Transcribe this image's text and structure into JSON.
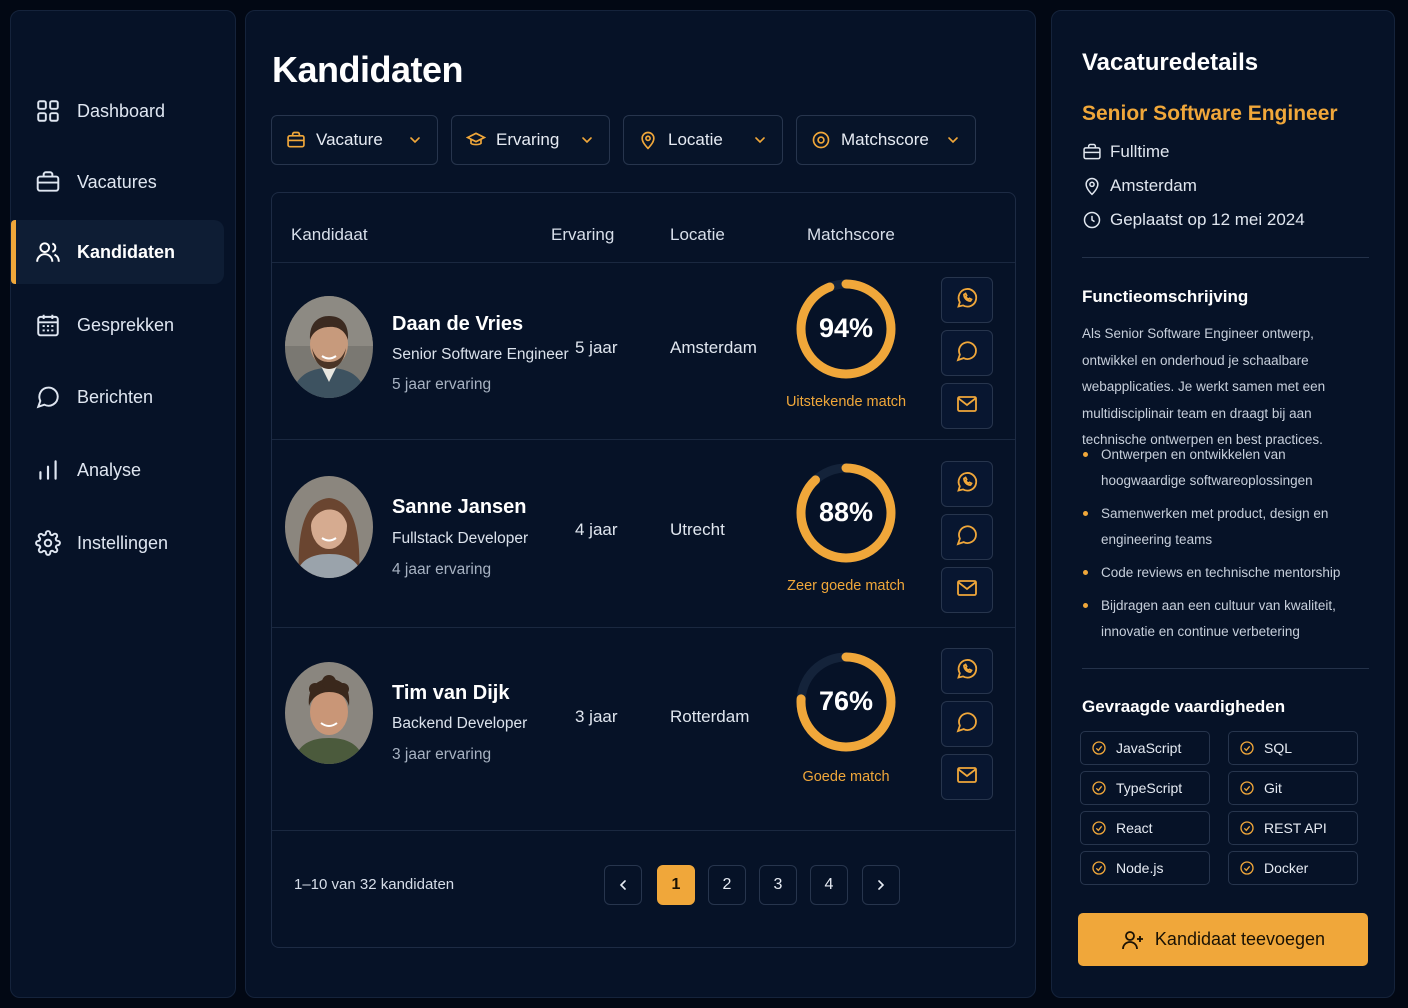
{
  "colors": {
    "accent": "#f0a73a",
    "background": "#020814",
    "panel": "#061227",
    "ring_track": "#14233a"
  },
  "sidebar": {
    "items": [
      {
        "label": "Dashboard",
        "icon": "grid-icon",
        "active": false
      },
      {
        "label": "Vacatures",
        "icon": "briefcase-icon",
        "active": false
      },
      {
        "label": "Kandidaten",
        "icon": "users-icon",
        "active": true
      },
      {
        "label": "Gesprekken",
        "icon": "calendar-icon",
        "active": false
      },
      {
        "label": "Berichten",
        "icon": "message-icon",
        "active": false
      },
      {
        "label": "Analyse",
        "icon": "bar-chart-icon",
        "active": false
      },
      {
        "label": "Instellingen",
        "icon": "gear-icon",
        "active": false
      }
    ]
  },
  "main": {
    "title": "Kandidaten",
    "filters": [
      {
        "label": "Vacature",
        "icon": "briefcase-icon"
      },
      {
        "label": "Ervaring",
        "icon": "graduation-cap-icon"
      },
      {
        "label": "Locatie",
        "icon": "map-pin-icon"
      },
      {
        "label": "Matchscore",
        "icon": "target-icon"
      }
    ],
    "table": {
      "headers": {
        "kandidaat": "Kandidaat",
        "ervaring": "Ervaring",
        "locatie": "Locatie",
        "matchscore": "Matchscore"
      },
      "rows": [
        {
          "name": "Daan de Vries",
          "role": "Senior Software Engineer",
          "experience_text": "5 jaar ervaring",
          "experience": "5 jaar",
          "location": "Amsterdam",
          "score_label": "94%",
          "score": 0.94,
          "match_label": "Uitstekende match"
        },
        {
          "name": "Sanne Jansen",
          "role": "Fullstack Developer",
          "experience_text": "4 jaar ervaring",
          "experience": "4 jaar",
          "location": "Utrecht",
          "score_label": "88%",
          "score": 0.88,
          "match_label": "Zeer goede match"
        },
        {
          "name": "Tim van Dijk",
          "role": "Backend Developer",
          "experience_text": "3 jaar ervaring",
          "experience": "3 jaar",
          "location": "Rotterdam",
          "score_label": "76%",
          "score": 0.76,
          "match_label": "Goede match"
        }
      ],
      "actions": [
        "whatsapp-icon",
        "chat-bubble-icon",
        "mail-icon"
      ]
    },
    "pagination": {
      "info": "1–10 van 32 kandidaten",
      "pages": [
        "1",
        "2",
        "3",
        "4"
      ],
      "current": "1"
    }
  },
  "details": {
    "title": "Vacaturedetails",
    "job_title": "Senior Software Engineer",
    "meta": [
      {
        "icon": "briefcase-icon",
        "text": "Fulltime"
      },
      {
        "icon": "map-pin-icon",
        "text": "Amsterdam"
      },
      {
        "icon": "clock-icon",
        "text": "Geplaatst op 12 mei 2024"
      }
    ],
    "description_title": "Functieomschrijving",
    "description": "Als Senior Software Engineer ontwerp, ontwikkel en onderhoud je schaalbare webapplicaties. Je werkt samen met een multidisciplinair team en draagt bij aan technische ontwerpen en best practices.",
    "bullets": [
      "Ontwerpen en ontwikkelen van hoogwaardige softwareoplossingen",
      "Samenwerken met product, design en engineering teams",
      "Code reviews en technische mentorship",
      "Bijdragen aan een cultuur van kwaliteit, innovatie en continue verbetering"
    ],
    "skills_title": "Gevraagde vaardigheden",
    "skills": [
      "JavaScript",
      "SQL",
      "TypeScript",
      "Git",
      "React",
      "REST API",
      "Node.js",
      "Docker"
    ],
    "add_button": "Kandidaat teevoegen"
  }
}
